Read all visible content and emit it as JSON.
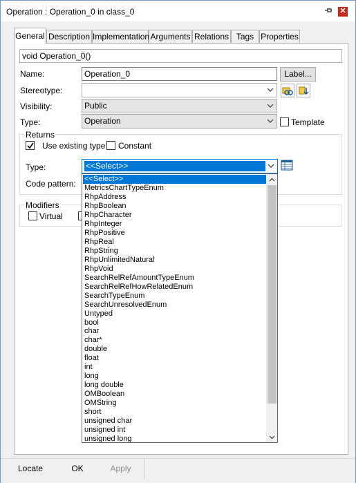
{
  "window": {
    "title": "Operation : Operation_0 in class_0",
    "close_label": "✕",
    "pin_icon": "pin-icon"
  },
  "tabs": [
    "General",
    "Description",
    "Implementation",
    "Arguments",
    "Relations",
    "Tags",
    "Properties"
  ],
  "general": {
    "signature": "void Operation_0()",
    "name_label": "Name:",
    "name_value": "Operation_0",
    "label_button": "Label...",
    "stereotype_label": "Stereotype:",
    "stereotype_value": "",
    "visibility_label": "Visibility:",
    "visibility_value": "Public",
    "type_label": "Type:",
    "type_value": "Operation",
    "template_label": "Template"
  },
  "returns": {
    "group_label": "Returns",
    "use_existing_label": "Use existing type",
    "use_existing_checked": true,
    "constant_label": "Constant",
    "type_label": "Type:",
    "type_value": "<<Select>>",
    "code_pattern_label": "Code pattern:"
  },
  "modifiers": {
    "group_label": "Modifiers",
    "virtual_label": "Virtual"
  },
  "dropdown": {
    "selected": "<<Select>>",
    "items": [
      "<<Select>>",
      "MetricsChartTypeEnum",
      "RhpAddress",
      "RhpBoolean",
      "RhpCharacter",
      "RhpInteger",
      "RhpPositive",
      "RhpReal",
      "RhpString",
      "RhpUnlimitedNatural",
      "RhpVoid",
      "SearchRelRefAmountTypeEnum",
      "SearchRelRefHowRelatedEnum",
      "SearchTypeEnum",
      "SearchUnresolvedEnum",
      "Untyped",
      "bool",
      "char",
      "char*",
      "double",
      "float",
      "int",
      "long",
      "long double",
      "OMBoolean",
      "OMString",
      "short",
      "unsigned char",
      "unsigned int",
      "unsigned long"
    ]
  },
  "footer": {
    "locate": "Locate",
    "ok": "OK",
    "apply": "Apply"
  },
  "colors": {
    "selection": "#0078d7",
    "window_border": "#6e98c8",
    "close": "#c42b1c"
  }
}
